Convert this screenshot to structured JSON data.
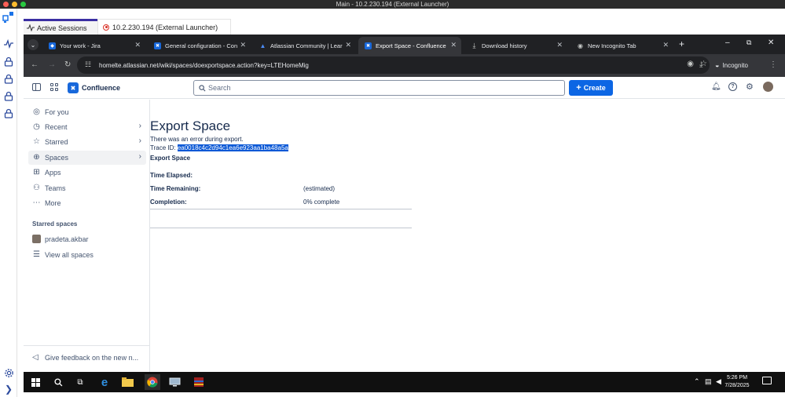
{
  "window": {
    "title": "Main - 10.2.230.194 (External Launcher)"
  },
  "sessions": {
    "tabs": [
      {
        "label": "Active Sessions"
      },
      {
        "label": "10.2.230.194 (External Launcher)"
      }
    ]
  },
  "browser": {
    "tabs": [
      {
        "label": "Your work - Jira",
        "favicon_color": "#1868db"
      },
      {
        "label": "General configuration - Con",
        "favicon_color": "#1868db"
      },
      {
        "label": "Atlassian Community | Learn",
        "favicon_color": "#1868db"
      },
      {
        "label": "Export Space - Confluence",
        "favicon_color": "#1868db"
      },
      {
        "label": "Download history",
        "favicon_color": "#c4c7c5"
      },
      {
        "label": "New Incognito Tab",
        "favicon_color": "#c4c7c5"
      }
    ],
    "url": "homelte.atlassian.net/wiki/spaces/doexportspace.action?key=LTEHomeMig",
    "incognito_label": "Incognito"
  },
  "confluence": {
    "brand": "Confluence",
    "search_placeholder": "Search",
    "create_label": "Create",
    "sidebar": {
      "items": [
        {
          "label": "For you",
          "icon": "user-circle-icon"
        },
        {
          "label": "Recent",
          "icon": "clock-icon"
        },
        {
          "label": "Starred",
          "icon": "star-icon"
        },
        {
          "label": "Spaces",
          "icon": "globe-icon"
        },
        {
          "label": "Apps",
          "icon": "apps-icon"
        },
        {
          "label": "Teams",
          "icon": "teams-icon"
        },
        {
          "label": "More",
          "icon": "more-icon"
        }
      ],
      "starred_heading": "Starred spaces",
      "starred": [
        {
          "label": "pradeta.akbar"
        },
        {
          "label": "View all spaces"
        }
      ],
      "feedback": "Give feedback on the new n..."
    },
    "page": {
      "title": "Export Space",
      "error": "There was an error during export.",
      "trace_label": "Trace ID: ",
      "trace_id": "ea0018c4c2d94c1ea6e923aa1ba48a5a",
      "section": "Export Space",
      "rows": [
        {
          "key": "Time Elapsed:",
          "value": ""
        },
        {
          "key": "Time Remaining:",
          "value": "(estimated)"
        },
        {
          "key": "Completion:",
          "value": "0% complete"
        }
      ]
    }
  },
  "taskbar": {
    "time": "5:26 PM",
    "date": "7/28/2025"
  },
  "colors": {
    "accent": "#0c66e4",
    "selection": "#0a58d6",
    "chrome_dark": "#202124"
  }
}
